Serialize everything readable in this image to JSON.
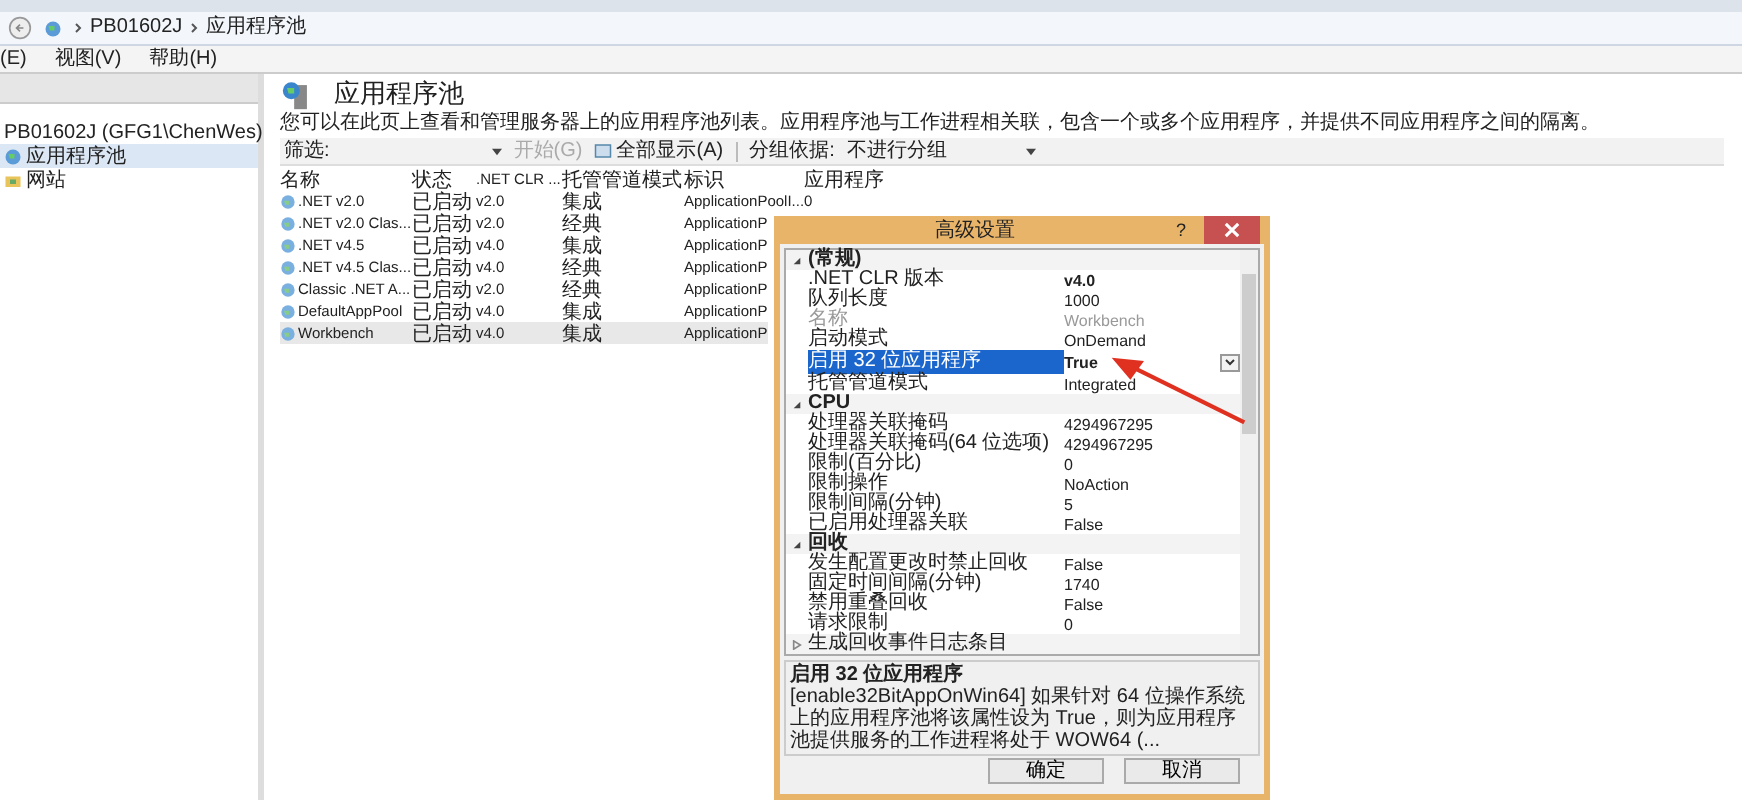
{
  "breadcrumb": [
    "PB01602J",
    "应用程序池"
  ],
  "menu": [
    "(E)",
    "视图(V)",
    "帮助(H)"
  ],
  "tree": [
    {
      "label": "PB01602J (GFG1\\ChenWes)",
      "selected": false,
      "children": [
        {
          "label": "应用程序池",
          "selected": true
        },
        {
          "label": "网站",
          "selected": false
        }
      ]
    }
  ],
  "page": {
    "title": "应用程序池",
    "description": "您可以在此页上查看和管理服务器上的应用程序池列表。应用程序池与工作进程相关联，包含一个或多个应用程序，并提供不同应用程序之间的隔离。"
  },
  "toolbar": {
    "filter_label": "筛选:",
    "go": "开始(G)",
    "show_all": "全部显示(A)",
    "group_label": "分组依据:",
    "group_value": "不进行分组"
  },
  "table": {
    "columns": [
      "名称",
      "状态",
      ".NET CLR ...",
      "托管管道模式",
      "标识",
      "应用程序"
    ],
    "rows": [
      {
        "cells": [
          ".NET v2.0",
          "已启动",
          "v2.0",
          "集成",
          "ApplicationPoolI...",
          "0"
        ],
        "selected": false
      },
      {
        "cells": [
          ".NET v2.0 Clas...",
          "已启动",
          "v2.0",
          "经典",
          "ApplicationP"
        ],
        "selected": false
      },
      {
        "cells": [
          ".NET v4.5",
          "已启动",
          "v4.0",
          "集成",
          "ApplicationP"
        ],
        "selected": false
      },
      {
        "cells": [
          ".NET v4.5 Clas...",
          "已启动",
          "v4.0",
          "经典",
          "ApplicationP"
        ],
        "selected": false
      },
      {
        "cells": [
          "Classic .NET A...",
          "已启动",
          "v2.0",
          "经典",
          "ApplicationP"
        ],
        "selected": false
      },
      {
        "cells": [
          "DefaultAppPool",
          "已启动",
          "v4.0",
          "集成",
          "ApplicationP"
        ],
        "selected": false
      },
      {
        "cells": [
          "Workbench",
          "已启动",
          "v4.0",
          "集成",
          "ApplicationP"
        ],
        "selected": true
      }
    ]
  },
  "dialog": {
    "title": "高级设置",
    "help": "?",
    "categories": [
      {
        "name": "(常规)",
        "expanded": true,
        "items": [
          {
            "name": ".NET CLR 版本",
            "value": "v4.0",
            "modified": true,
            "disabled": false,
            "selected": false
          },
          {
            "name": "队列长度",
            "value": "1000",
            "modified": false,
            "disabled": false,
            "selected": false
          },
          {
            "name": "名称",
            "value": "Workbench",
            "modified": false,
            "disabled": true,
            "selected": false
          },
          {
            "name": "启动模式",
            "value": "OnDemand",
            "modified": false,
            "disabled": false,
            "selected": false
          },
          {
            "name": "启用 32 位应用程序",
            "value": "True",
            "modified": true,
            "disabled": false,
            "selected": true
          },
          {
            "name": "托管管道模式",
            "value": "Integrated",
            "modified": false,
            "disabled": false,
            "selected": false
          }
        ]
      },
      {
        "name": "CPU",
        "expanded": true,
        "items": [
          {
            "name": "处理器关联掩码",
            "value": "4294967295",
            "modified": false,
            "disabled": false,
            "selected": false
          },
          {
            "name": "处理器关联掩码(64 位选项)",
            "value": "4294967295",
            "modified": false,
            "disabled": false,
            "selected": false
          },
          {
            "name": "限制(百分比)",
            "value": "0",
            "modified": false,
            "disabled": false,
            "selected": false
          },
          {
            "name": "限制操作",
            "value": "NoAction",
            "modified": false,
            "disabled": false,
            "selected": false
          },
          {
            "name": "限制间隔(分钟)",
            "value": "5",
            "modified": false,
            "disabled": false,
            "selected": false
          },
          {
            "name": "已启用处理器关联",
            "value": "False",
            "modified": false,
            "disabled": false,
            "selected": false
          }
        ]
      },
      {
        "name": "回收",
        "expanded": true,
        "items": [
          {
            "name": "发生配置更改时禁止回收",
            "value": "False",
            "modified": false,
            "disabled": false,
            "selected": false
          },
          {
            "name": "固定时间间隔(分钟)",
            "value": "1740",
            "modified": false,
            "disabled": false,
            "selected": false
          },
          {
            "name": "禁用重叠回收",
            "value": "False",
            "modified": false,
            "disabled": false,
            "selected": false
          },
          {
            "name": "请求限制",
            "value": "0",
            "modified": false,
            "disabled": false,
            "selected": false
          }
        ]
      },
      {
        "name": "生成回收事件日志条目",
        "expanded": false
      }
    ],
    "help_title": "启用 32 位应用程序",
    "help_text": "[enable32BitAppOnWin64] 如果针对 64 位操作系统上的应用程序池将该属性设为 True，则为应用程序池提供服务的工作进程将处于 WOW64 (...",
    "buttons": [
      "确定",
      "取消"
    ]
  }
}
